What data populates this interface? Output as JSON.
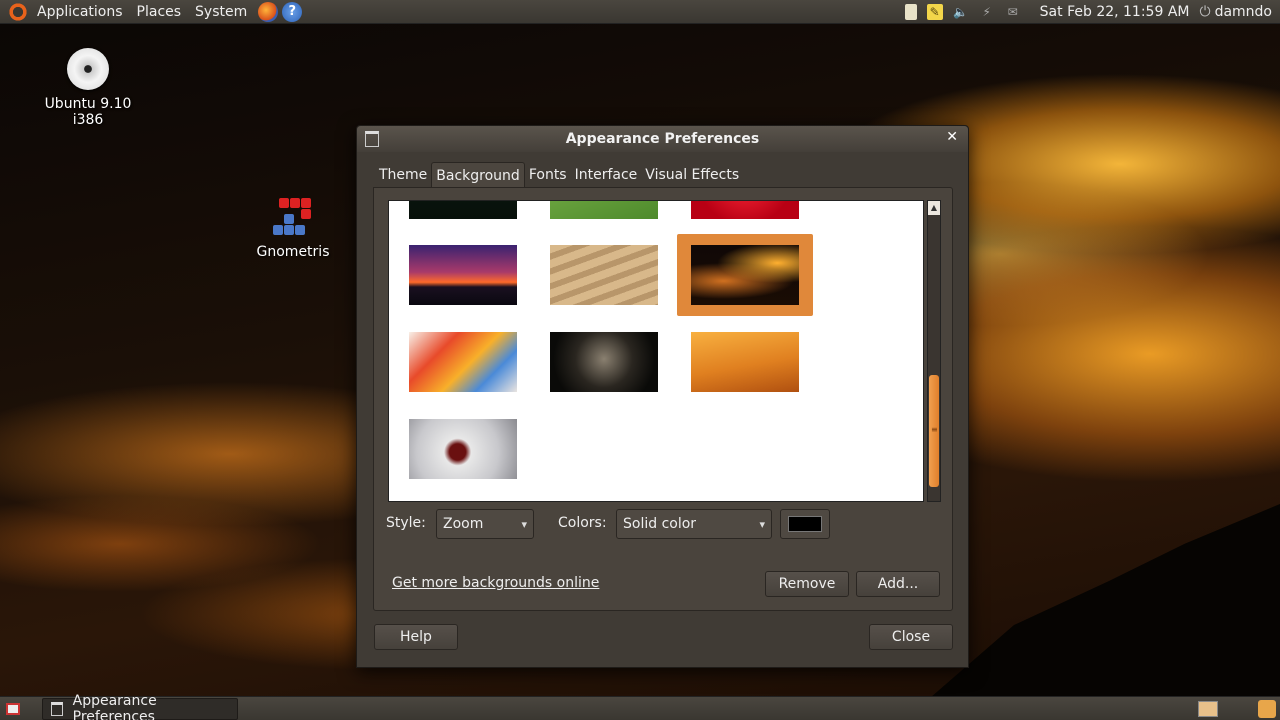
{
  "top_panel": {
    "menus": [
      "Applications",
      "Places",
      "System"
    ],
    "clock": "Sat Feb 22, 11:59 AM",
    "user": "damndo"
  },
  "desktop_icons": {
    "cd": "Ubuntu 9.10 i386",
    "gnometris": "Gnometris"
  },
  "dialog": {
    "title": "Appearance Preferences",
    "tabs": [
      "Theme",
      "Background",
      "Fonts",
      "Interface",
      "Visual Effects"
    ],
    "active_tab": "Background",
    "style_label": "Style:",
    "style_value": "Zoom",
    "colors_label": "Colors:",
    "colors_value": "Solid color",
    "color_swatch": "#000000",
    "get_more_link": "Get more backgrounds online",
    "remove_button": "Remove",
    "add_button": "Add...",
    "help_button": "Help",
    "close_button": "Close",
    "wallpapers": [
      "dark-wallpaper",
      "green-leaf",
      "red-flower",
      "purple-sunset",
      "sand-dunes",
      "orange-sunset-selected",
      "colored-pencils",
      "dark-sparkles",
      "orange-gradient",
      "white-orchid"
    ]
  },
  "bottom_panel": {
    "task": "Appearance Preferences"
  }
}
